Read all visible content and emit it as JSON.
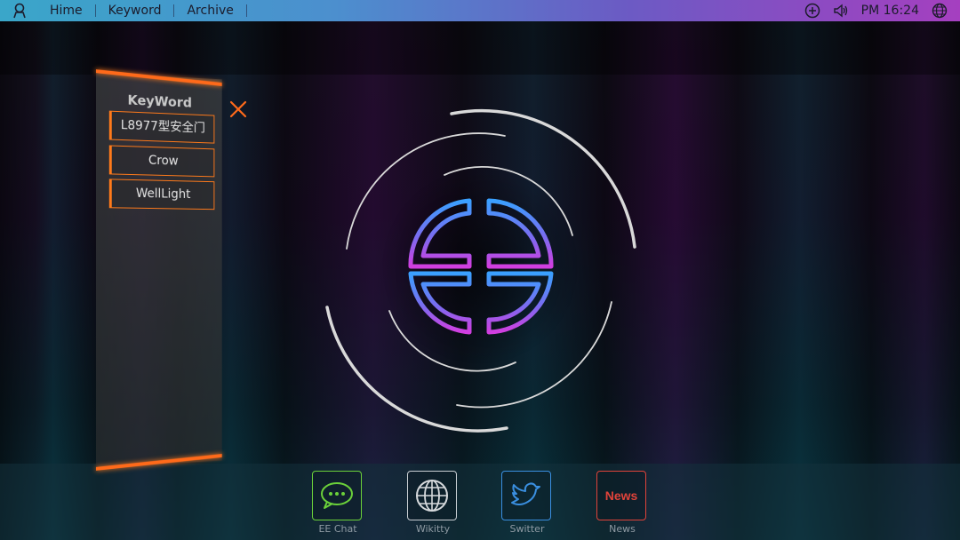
{
  "topbar": {
    "menu": [
      "Hime",
      "Keyword",
      "Archive"
    ],
    "clock": "PM 16:24",
    "icons": [
      "profile-icon",
      "plus-circle-icon",
      "volume-icon",
      "globe-icon"
    ]
  },
  "keyword_panel": {
    "title": "KeyWord",
    "items": [
      "L8977型安全门",
      "Crow",
      "WellLight"
    ],
    "close_icon": "close-icon"
  },
  "dock": {
    "items": [
      {
        "label": "EE Chat",
        "icon": "chat-icon",
        "color": "#6bd13a"
      },
      {
        "label": "Wikitty",
        "icon": "globe-icon",
        "color": "#c9ced3"
      },
      {
        "label": "Switter",
        "icon": "bird-icon",
        "color": "#3a8fe0"
      },
      {
        "label": "News",
        "icon": "news-icon",
        "icon_text": "News",
        "color": "#e0433a"
      }
    ]
  },
  "colors": {
    "accent": "#ff7a1a",
    "topbar_gradient": [
      "#3aa6c9",
      "#a53fc0"
    ],
    "emblem_gradient": [
      "#3aa0ff",
      "#c93ee0"
    ]
  }
}
